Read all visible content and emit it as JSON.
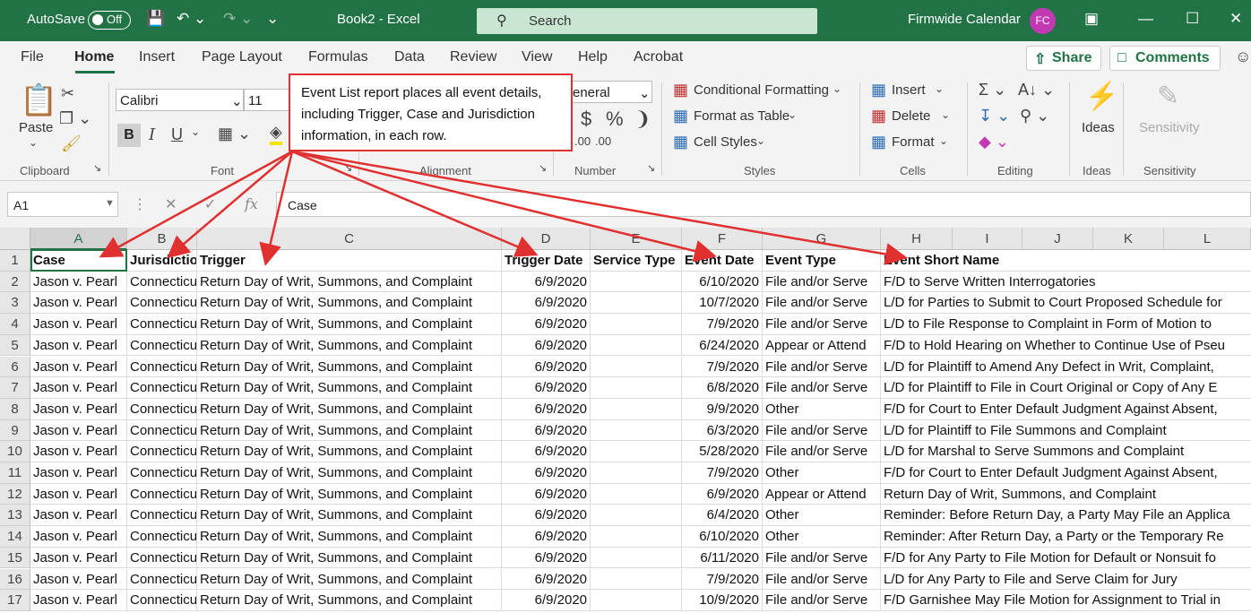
{
  "titlebar": {
    "autosave_label": "AutoSave",
    "autosave_state": "Off",
    "doc_title": "Book2  -  Excel",
    "search_placeholder": "Search",
    "calendar": "Firmwide Calendar",
    "avatar_initials": "FC"
  },
  "menu": {
    "tabs": [
      "File",
      "Home",
      "Insert",
      "Page Layout",
      "Formulas",
      "Data",
      "Review",
      "View",
      "Help",
      "Acrobat"
    ],
    "share": "Share",
    "comments": "Comments"
  },
  "ribbon": {
    "clipboard": {
      "paste": "Paste",
      "label": "Clipboard"
    },
    "font": {
      "name": "Calibri",
      "size": "11",
      "label": "Font"
    },
    "alignment": {
      "label": "Alignment"
    },
    "number": {
      "format": "eneral",
      "label": "Number"
    },
    "styles": {
      "conditional": "Conditional Formatting",
      "table": "Format as Table",
      "cell_styles": "Cell Styles",
      "label": "Styles"
    },
    "cells": {
      "insert": "Insert",
      "delete": "Delete",
      "format": "Format",
      "label": "Cells"
    },
    "editing": {
      "label": "Editing"
    },
    "ideas": {
      "button": "Ideas",
      "label": "Ideas"
    },
    "sensitivity": {
      "button": "Sensitivity",
      "label": "Sensitivity"
    }
  },
  "callout": {
    "text": "Event List report places all event details, including Trigger, Case and Jurisdiction information, in each row."
  },
  "formula_bar": {
    "name_box": "A1",
    "formula": "Case"
  },
  "grid": {
    "columns": [
      "A",
      "B",
      "C",
      "D",
      "E",
      "F",
      "G",
      "H",
      "I",
      "J",
      "K",
      "L"
    ],
    "header_row": [
      "Case",
      "Jurisdiction",
      "Trigger",
      "Trigger Date",
      "Service Type",
      "Event Date",
      "Event Type",
      "Event Short Name"
    ],
    "rows": [
      [
        "Jason v. Pearl",
        "Connecticut",
        "Return Day of Writ, Summons, and Complaint",
        "6/9/2020",
        "",
        "6/10/2020",
        "File and/or Serve",
        "F/D to Serve Written Interrogatories"
      ],
      [
        "Jason v. Pearl",
        "Connecticut",
        "Return Day of Writ, Summons, and Complaint",
        "6/9/2020",
        "",
        "10/7/2020",
        "File and/or Serve",
        "L/D for Parties to Submit to Court Proposed Schedule for"
      ],
      [
        "Jason v. Pearl",
        "Connecticut",
        "Return Day of Writ, Summons, and Complaint",
        "6/9/2020",
        "",
        "7/9/2020",
        "File and/or Serve",
        "L/D to File Response to Complaint in Form of Motion to"
      ],
      [
        "Jason v. Pearl",
        "Connecticut",
        "Return Day of Writ, Summons, and Complaint",
        "6/9/2020",
        "",
        "6/24/2020",
        "Appear or Attend",
        "F/D to Hold Hearing on Whether to Continue Use of Pseu"
      ],
      [
        "Jason v. Pearl",
        "Connecticut",
        "Return Day of Writ, Summons, and Complaint",
        "6/9/2020",
        "",
        "7/9/2020",
        "File and/or Serve",
        "L/D for Plaintiff to Amend Any Defect in Writ, Complaint,"
      ],
      [
        "Jason v. Pearl",
        "Connecticut",
        "Return Day of Writ, Summons, and Complaint",
        "6/9/2020",
        "",
        "6/8/2020",
        "File and/or Serve",
        "L/D for Plaintiff to File in Court Original or Copy of Any E"
      ],
      [
        "Jason v. Pearl",
        "Connecticut",
        "Return Day of Writ, Summons, and Complaint",
        "6/9/2020",
        "",
        "9/9/2020",
        "Other",
        "F/D for Court to Enter Default Judgment Against Absent,"
      ],
      [
        "Jason v. Pearl",
        "Connecticut",
        "Return Day of Writ, Summons, and Complaint",
        "6/9/2020",
        "",
        "6/3/2020",
        "File and/or Serve",
        "L/D for Plaintiff to File Summons and Complaint"
      ],
      [
        "Jason v. Pearl",
        "Connecticut",
        "Return Day of Writ, Summons, and Complaint",
        "6/9/2020",
        "",
        "5/28/2020",
        "File and/or Serve",
        "L/D for Marshal to Serve Summons and Complaint"
      ],
      [
        "Jason v. Pearl",
        "Connecticut",
        "Return Day of Writ, Summons, and Complaint",
        "6/9/2020",
        "",
        "7/9/2020",
        "Other",
        "F/D for Court to Enter Default Judgment Against Absent,"
      ],
      [
        "Jason v. Pearl",
        "Connecticut",
        "Return Day of Writ, Summons, and Complaint",
        "6/9/2020",
        "",
        "6/9/2020",
        "Appear or Attend",
        "Return Day of Writ, Summons, and Complaint"
      ],
      [
        "Jason v. Pearl",
        "Connecticut",
        "Return Day of Writ, Summons, and Complaint",
        "6/9/2020",
        "",
        "6/4/2020",
        "Other",
        "Reminder: Before Return Day, a Party May File an Applica"
      ],
      [
        "Jason v. Pearl",
        "Connecticut",
        "Return Day of Writ, Summons, and Complaint",
        "6/9/2020",
        "",
        "6/10/2020",
        "Other",
        "Reminder: After Return Day, a Party or the Temporary Re"
      ],
      [
        "Jason v. Pearl",
        "Connecticut",
        "Return Day of Writ, Summons, and Complaint",
        "6/9/2020",
        "",
        "6/11/2020",
        "File and/or Serve",
        "F/D for Any Party to File Motion for Default or Nonsuit fo"
      ],
      [
        "Jason v. Pearl",
        "Connecticut",
        "Return Day of Writ, Summons, and Complaint",
        "6/9/2020",
        "",
        "7/9/2020",
        "File and/or Serve",
        "L/D for Any Party to File and Serve Claim for Jury"
      ],
      [
        "Jason v. Pearl",
        "Connecticut",
        "Return Day of Writ, Summons, and Complaint",
        "6/9/2020",
        "",
        "10/9/2020",
        "File and/or Serve",
        "F/D Garnishee May File Motion for Assignment to Trial in"
      ]
    ]
  },
  "colors": {
    "excel_green": "#217346",
    "callout_red": "#e03030"
  }
}
